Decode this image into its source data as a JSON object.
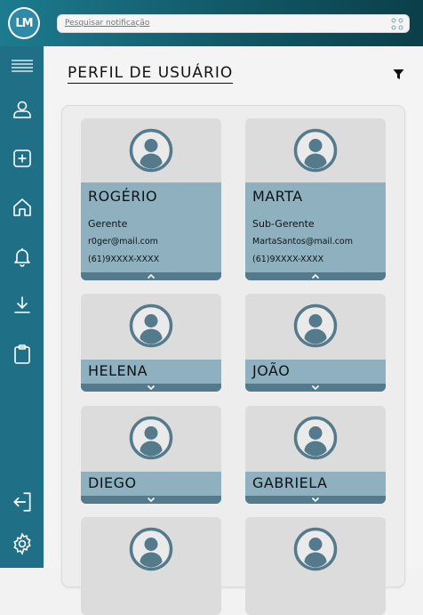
{
  "app": {
    "logo_text": "LM"
  },
  "search": {
    "placeholder": "Pesquisar notificação"
  },
  "page": {
    "title": "PERFIL DE USUÁRIO"
  },
  "sidebar": {
    "items": [
      {
        "name": "menu",
        "icon": "hamburger-icon"
      },
      {
        "name": "profile",
        "icon": "user-icon"
      },
      {
        "name": "add",
        "icon": "plus-square-icon"
      },
      {
        "name": "home",
        "icon": "home-icon"
      },
      {
        "name": "notifications",
        "icon": "bell-icon"
      },
      {
        "name": "download",
        "icon": "download-icon"
      },
      {
        "name": "clipboard",
        "icon": "clipboard-icon"
      },
      {
        "name": "logout",
        "icon": "logout-icon"
      },
      {
        "name": "settings",
        "icon": "gear-icon"
      }
    ]
  },
  "users": [
    {
      "name": "ROGÉRIO",
      "role": "Gerente",
      "email": "r0ger@mail.com",
      "phone": "(61)9XXXX-XXXX",
      "expanded": true
    },
    {
      "name": "MARTA",
      "role": "Sub-Gerente",
      "email": "MartaSantos@mail.com",
      "phone": "(61)9XXXX-XXXX",
      "expanded": true
    },
    {
      "name": "HELENA",
      "expanded": false
    },
    {
      "name": "JOÃO",
      "expanded": false
    },
    {
      "name": "DIEGO",
      "expanded": false
    },
    {
      "name": "GABRIELA",
      "expanded": false
    }
  ],
  "colors": {
    "accent": "#1f6f86",
    "card_band": "#8fb0be",
    "card_bg": "#dcdcdc",
    "avatar": "#557a8c"
  }
}
